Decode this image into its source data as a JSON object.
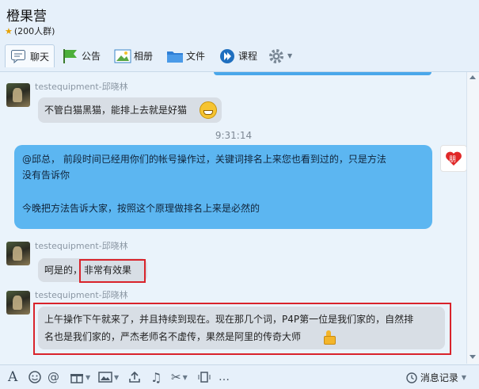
{
  "header": {
    "group_name": "橙果营",
    "member_count": "(200人群)"
  },
  "tabs": [
    {
      "label": "聊天",
      "icon": "chat-bubble-icon"
    },
    {
      "label": "公告",
      "icon": "flag-icon"
    },
    {
      "label": "相册",
      "icon": "photo-icon"
    },
    {
      "label": "文件",
      "icon": "folder-icon"
    },
    {
      "label": "课程",
      "icon": "course-play-icon"
    }
  ],
  "messages": [
    {
      "sender": "testequipment-邱晓林",
      "text": "不管白猫黑猫，能排上去就是好猫"
    },
    {
      "timestamp": "9:31:14"
    },
    {
      "self_line1": "@邱总， 前段时间已经用你们的帐号操作过，关键词排名上来您也看到过的，只是方法",
      "self_line2": "没有告诉你",
      "self_line3": "今晚把方法告诉大家，按照这个原理做排名上来是必然的"
    },
    {
      "sender": "testequipment-邱晓林",
      "text_prefix": "呵是的，",
      "text_highlight": "非常有效果"
    },
    {
      "sender": "testequipment-邱晓林",
      "line1": "上午操作下午就来了，并且持续到现在。现在那几个词，P4P第一位是我们家的，自然排",
      "line2": "名也是我们家的，严杰老师名不虚传，果然是阿里的传奇大师"
    }
  ],
  "self_avatar_badge": "朋",
  "toolbar": {
    "history_label": "消息记录"
  },
  "colors": {
    "accent_blue": "#5cb6f1",
    "highlight_red": "#d9232b",
    "incoming_bubble": "#d8dee5"
  }
}
